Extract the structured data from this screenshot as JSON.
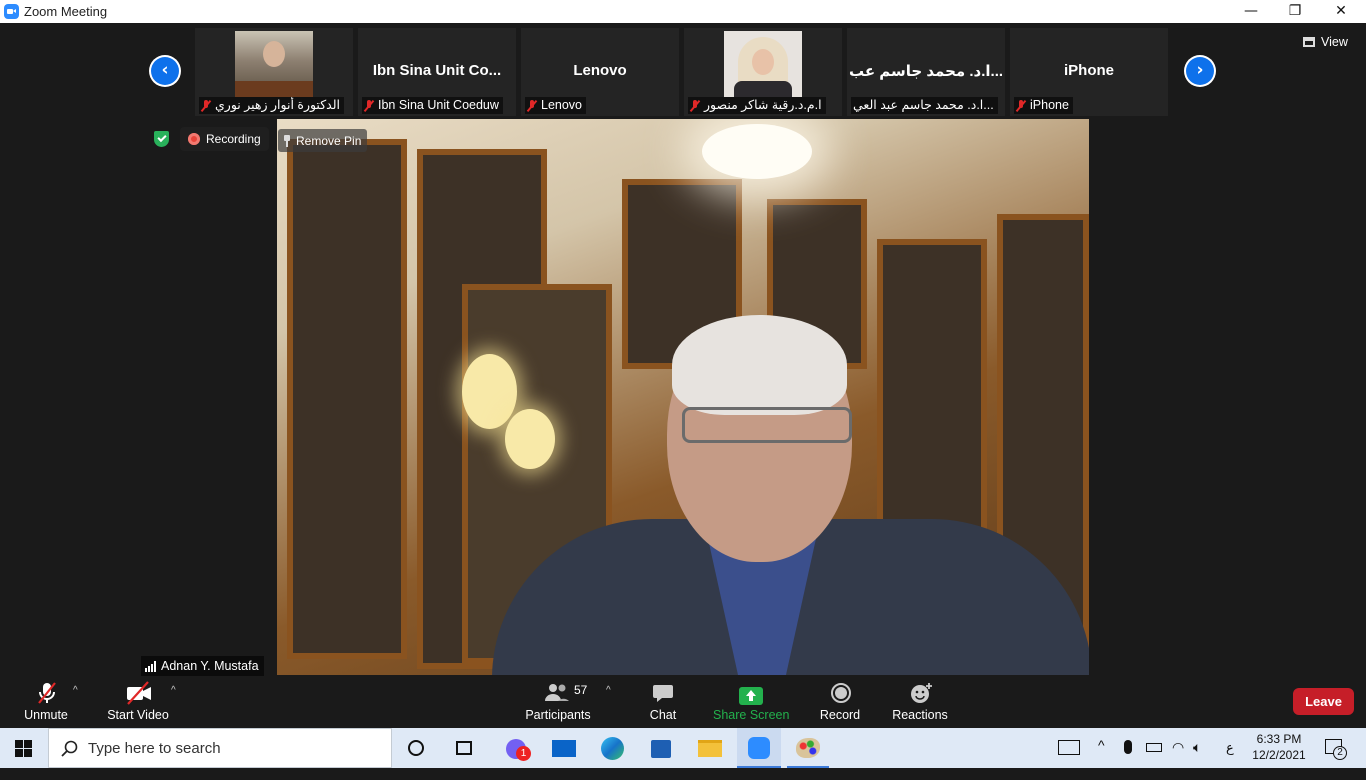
{
  "window": {
    "title": "Zoom Meeting",
    "minimize": "—",
    "restore": "❐",
    "close": "✕"
  },
  "view_button": {
    "label": "View"
  },
  "participant_strip": {
    "tiles": [
      {
        "display": "",
        "label": "الدكتورة أنوار زهير نوري",
        "muted": true,
        "has_photo": true
      },
      {
        "display": "Ibn Sina Unit Co...",
        "label": "Ibn Sina Unit Coeduw",
        "muted": true,
        "has_photo": false
      },
      {
        "display": "Lenovo",
        "label": "Lenovo",
        "muted": true,
        "has_photo": false
      },
      {
        "display": "",
        "label": "ا.م.د.رقية شاكر منصور",
        "muted": true,
        "has_photo": true
      },
      {
        "display": "...ا.د. محمد جاسم عب",
        "label": "...ا.د. محمد جاسم عبد العي",
        "muted": true,
        "has_photo": false
      },
      {
        "display": "iPhone",
        "label": "iPhone",
        "muted": true,
        "has_photo": false
      }
    ]
  },
  "status": {
    "recording_label": "Recording",
    "remove_pin_label": "Remove Pin"
  },
  "active_speaker": {
    "name": "Adnan Y. Mustafa"
  },
  "toolbar": {
    "unmute_label": "Unmute",
    "start_video_label": "Start Video",
    "participants_label": "Participants",
    "participants_count": "57",
    "chat_label": "Chat",
    "share_screen_label": "Share Screen",
    "record_label": "Record",
    "reactions_label": "Reactions",
    "leave_label": "Leave"
  },
  "taskbar": {
    "search_placeholder": "Type here to search",
    "chat_badge": "1",
    "time": "6:33 PM",
    "date": "12/2/2021",
    "input_lang": "ع",
    "notification_count": "2"
  },
  "colors": {
    "zoom_blue": "#0e71eb",
    "leave_red": "#c61e28",
    "share_green": "#23b14d",
    "recording_red": "#e8443a"
  }
}
